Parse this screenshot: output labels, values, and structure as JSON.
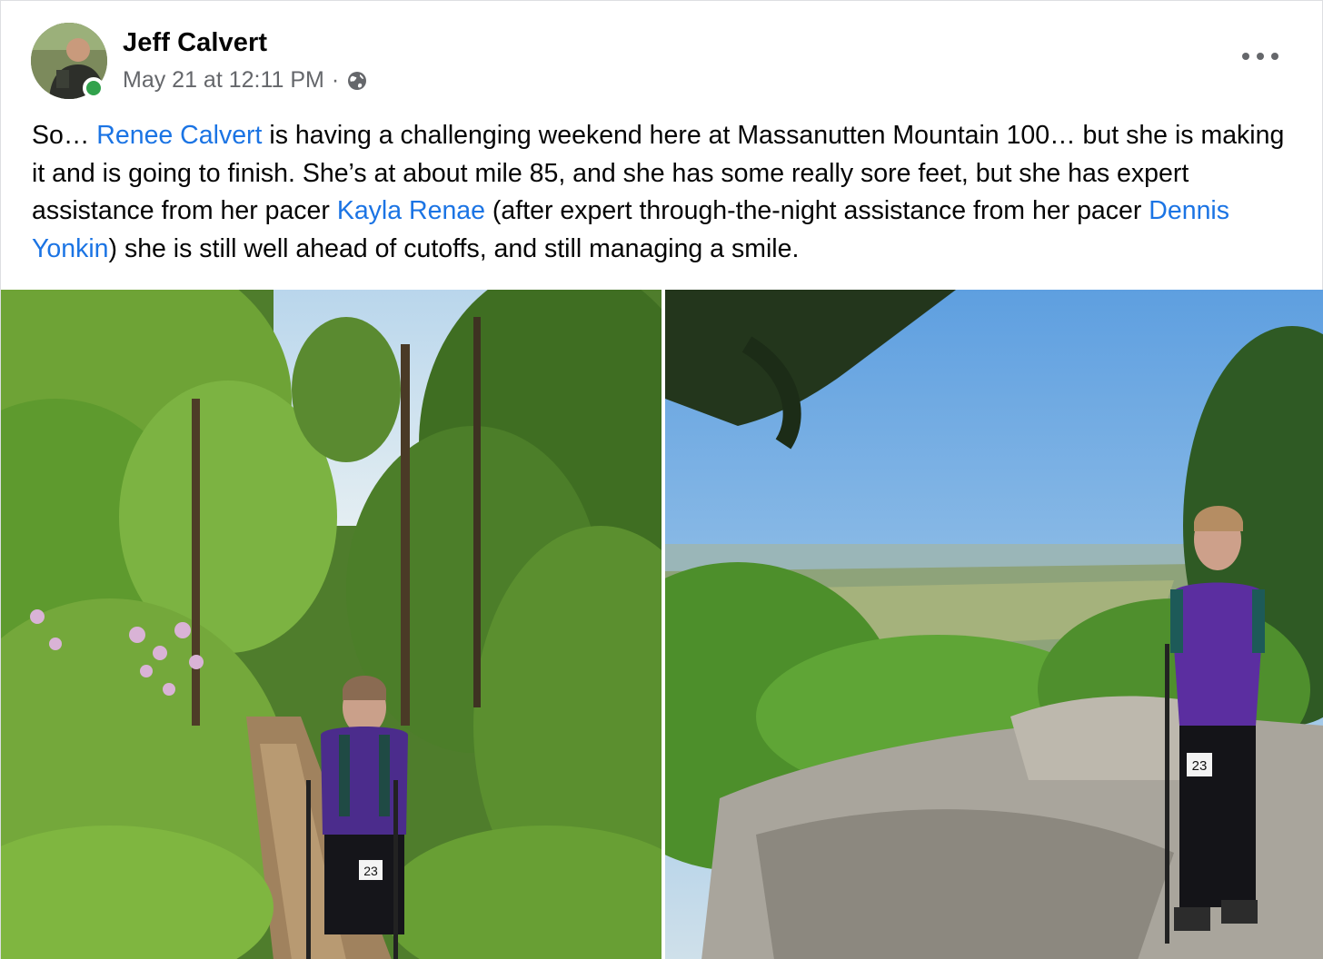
{
  "post": {
    "author": "Jeff Calvert",
    "timestamp": "May 21 at 12:11 PM",
    "separator": "·",
    "audience_icon": "globe-icon",
    "more_icon": "more-options-icon",
    "body": [
      {
        "type": "text",
        "value": "So… "
      },
      {
        "type": "mention",
        "value": "Renee Calvert"
      },
      {
        "type": "text",
        "value": " is having a challenging weekend here at Massanutten Mountain 100… but she is making it and is going to finish. She’s at about mile 85, and she has some really sore feet, but she has expert assistance from her pacer "
      },
      {
        "type": "mention",
        "value": "Kayla Renae"
      },
      {
        "type": "text",
        "value": " (after expert through-the-night assistance from her pacer "
      },
      {
        "type": "mention",
        "value": "Dennis Yonkin"
      },
      {
        "type": "text",
        "value": ") she is still well ahead of cutoffs, and still managing a smile."
      }
    ],
    "photos": [
      {
        "name": "photo-trail-runner-forest",
        "bib": "23"
      },
      {
        "name": "photo-trail-runner-overlook",
        "bib": "23"
      }
    ]
  },
  "colors": {
    "mention": "#1b74e4",
    "meta": "#65676b",
    "online": "#31a24c"
  }
}
